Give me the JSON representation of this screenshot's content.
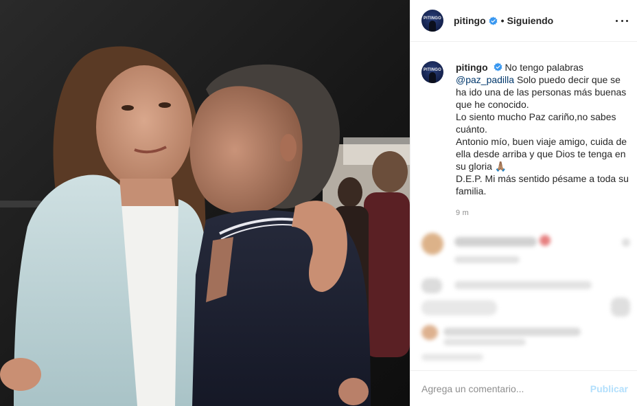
{
  "post": {
    "username": "pitingo",
    "avatar_text": "PITINGO",
    "follow_separator": "•",
    "follow_status": "Siguiendo",
    "more_options": "..."
  },
  "caption": {
    "username": "pitingo",
    "lines": [
      "No tengo palabras",
      "@paz_padilla",
      "Solo puedo decir que se ha ido una de las personas más buenas que he conocido.",
      "Lo siento mucho Paz cariño,no sabes cuánto.",
      "Antonio mío, buen viaje amigo, cuida de ella desde arriba y que Dios te tenga en su gloria 🙏🏽",
      "D.E.P. Mi más sentido pésame a toda su familia."
    ],
    "time": "9 m"
  },
  "comment_bar": {
    "placeholder": "Agrega un comentario...",
    "publish_label": "Publicar"
  },
  "colors": {
    "verified_blue": "#3897f0",
    "mention": "#00376b",
    "publish_disabled": "#b2dffc",
    "muted_text": "#8e8e8e",
    "border": "#efefef"
  },
  "icons": {
    "verified": "verified-badge-icon",
    "more": "more-options-icon"
  }
}
